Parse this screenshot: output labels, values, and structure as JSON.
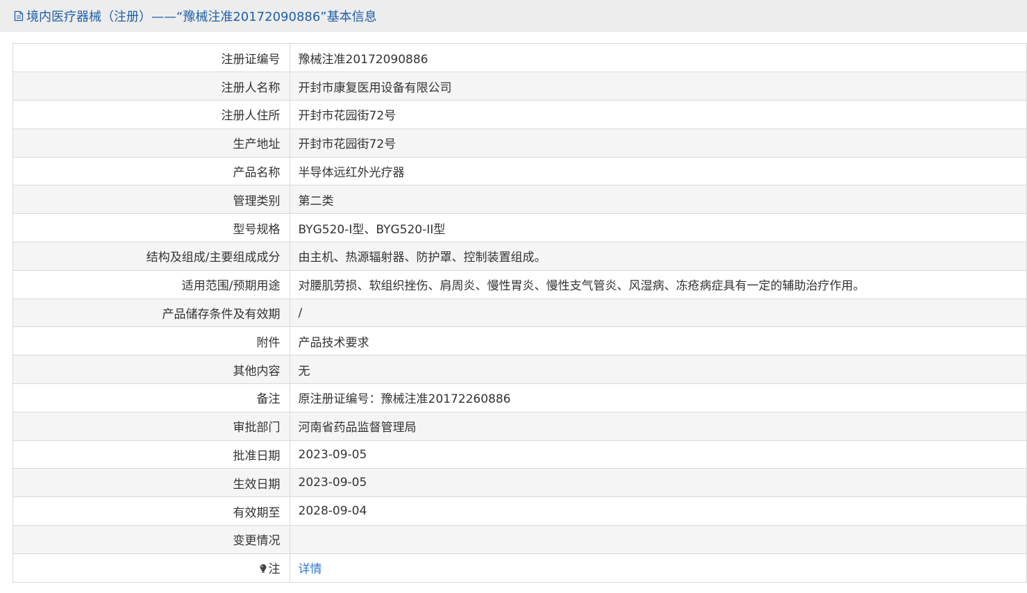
{
  "header": {
    "icon": "document-icon",
    "title": "境内医疗器械（注册）——“豫械注准20172090886”基本信息"
  },
  "rows": [
    {
      "label": "注册证编号",
      "value": "豫械注准20172090886"
    },
    {
      "label": "注册人名称",
      "value": "开封市康复医用设备有限公司"
    },
    {
      "label": "注册人住所",
      "value": "开封市花园街72号"
    },
    {
      "label": "生产地址",
      "value": "开封市花园街72号"
    },
    {
      "label": "产品名称",
      "value": "半导体远红外光疗器"
    },
    {
      "label": "管理类别",
      "value": "第二类"
    },
    {
      "label": "型号规格",
      "value": "BYG520-I型、BYG520-II型"
    },
    {
      "label": "结构及组成/主要组成成分",
      "value": "由主机、热源辐射器、防护罩、控制装置组成。"
    },
    {
      "label": "适用范围/预期用途",
      "value": "对腰肌劳损、软组织挫伤、肩周炎、慢性胃炎、慢性支气管炎、风湿病、冻疮病症具有一定的辅助治疗作用。"
    },
    {
      "label": "产品储存条件及有效期",
      "value": "/"
    },
    {
      "label": "附件",
      "value": "产品技术要求"
    },
    {
      "label": "其他内容",
      "value": "无"
    },
    {
      "label": "备注",
      "value": "原注册证编号：豫械注准20172260886"
    },
    {
      "label": "审批部门",
      "value": "河南省药品监督管理局"
    },
    {
      "label": "批准日期",
      "value": "2023-09-05"
    },
    {
      "label": "生效日期",
      "value": "2023-09-05"
    },
    {
      "label": "有效期至",
      "value": "2028-09-04"
    },
    {
      "label": "变更情况",
      "value": ""
    }
  ],
  "note": {
    "icon": "lightbulb-icon",
    "label": "注",
    "link_text": "详情"
  },
  "colors": {
    "header_bg": "#ededed",
    "title": "#1f5fa8",
    "link": "#2f7ad0",
    "alt_row": "#f5f5f5",
    "border": "#d9d9d9"
  }
}
